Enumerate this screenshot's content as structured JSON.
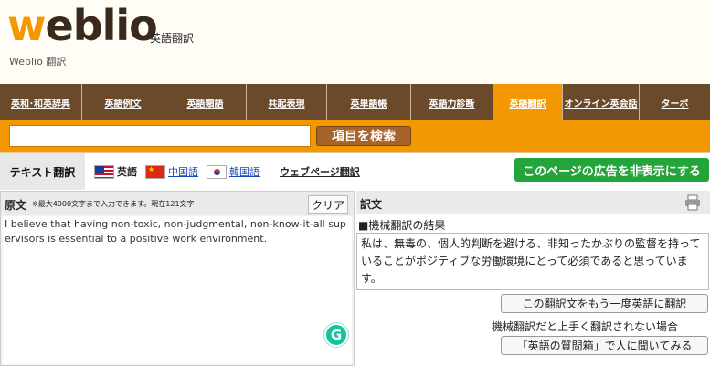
{
  "header": {
    "logo_w": "w",
    "logo_rest": "eblio",
    "logo_sub": "英語翻訳",
    "site_sub": "Weblio 翻訳"
  },
  "nav": {
    "items": [
      {
        "label": "英和･和英辞典"
      },
      {
        "label": "英語例文"
      },
      {
        "label": "英語類語"
      },
      {
        "label": "共起表現"
      },
      {
        "label": "英単語帳"
      },
      {
        "label": "英語力診断"
      },
      {
        "label": "英語翻訳"
      },
      {
        "label": "オンライン英会話"
      },
      {
        "label": "ターボ"
      }
    ],
    "active_index": 6
  },
  "search": {
    "value": "",
    "button_label": "項目を検索"
  },
  "tabs": {
    "text_translation": "テキスト翻訳",
    "english": "英語",
    "chinese": "中国語",
    "korean": "韓国語",
    "web_translation": "ウェブページ翻訳",
    "hide_ads": "このページの広告を非表示にする"
  },
  "source": {
    "label": "原文",
    "limit_note": "※最大4000文字まで入力できます。現在121文字",
    "clear_label": "クリア",
    "text": "I believe that having non-toxic, non-judgmental, non-know-it-all supervisors is essential to a positive work environment."
  },
  "result": {
    "label": "訳文",
    "heading": "■機械翻訳の結果",
    "text": "私は、無毒の、個人的判断を避ける、非知ったかぶりの監督を持っていることがポジティブな労働環境にとって必須であると思っています。",
    "retranslate_label": "この翻訳文をもう一度英語に翻訳",
    "fallback_note": "機械翻訳だと上手く翻訳されない場合",
    "ask_label": "「英語の質問箱」で人に聞いてみる"
  },
  "colors": {
    "brand_orange": "#f39800",
    "nav_brown": "#6b4a2c",
    "ads_green": "#24a53c"
  }
}
